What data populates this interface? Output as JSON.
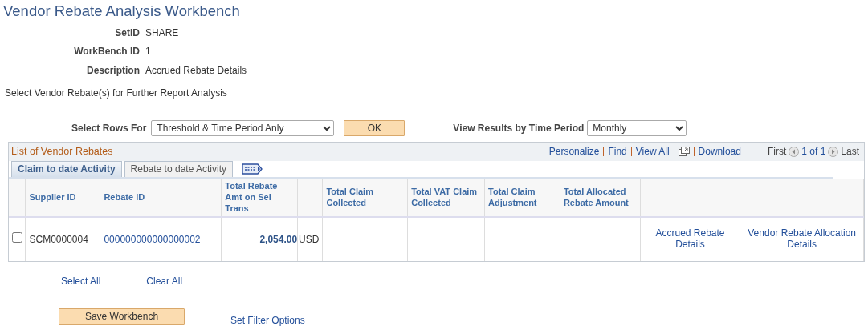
{
  "title": "Vendor Rebate Analysis Workbench",
  "fields": [
    {
      "label": "SetID",
      "value": "SHARE"
    },
    {
      "label": "WorkBench ID",
      "value": "1"
    },
    {
      "label": "Description",
      "value": "Accrued Rebate Details"
    }
  ],
  "instruction": "Select Vendor Rebate(s) for Further Report Analysis",
  "select_rows": {
    "label": "Select Rows For",
    "value": "Threshold & Time Period Anly"
  },
  "ok_button": "OK",
  "view_results": {
    "label": "View Results by Time Period",
    "value": "Monthly"
  },
  "grid": {
    "title": "List of Vendor Rebates",
    "toolbar": [
      "Personalize",
      "Find",
      "View All",
      "Download"
    ],
    "pagination": {
      "first": "First",
      "range": "1 of 1",
      "last": "Last"
    },
    "tabs": [
      {
        "label": "Claim to date Activity",
        "selected": true
      },
      {
        "label": "Rebate to date Activity",
        "selected": false
      }
    ],
    "columns": [
      {},
      {
        "label": "Supplier ID"
      },
      {
        "label": "Rebate ID"
      },
      {
        "label": "Total Rebate Amt on Sel Trans"
      },
      {},
      {
        "label": "Total Claim Collected"
      },
      {
        "label": "Total VAT Claim Collected"
      },
      {
        "label": "Total Claim Adjustment"
      },
      {
        "label": "Total Allocated Rebate Amount"
      },
      {},
      {}
    ],
    "rows": [
      {
        "checked": false,
        "supplier_id": "SCM0000004",
        "rebate_id": "000000000000000002",
        "amount": "2,054.00",
        "currency": "USD",
        "links": [
          "Accrued Rebate Details",
          "Vendor Rebate Allocation Details"
        ]
      }
    ]
  },
  "select_all": "Select All",
  "clear_all": "Clear All",
  "save_button": "Save Workbench",
  "filter_link": "Set Filter Options"
}
